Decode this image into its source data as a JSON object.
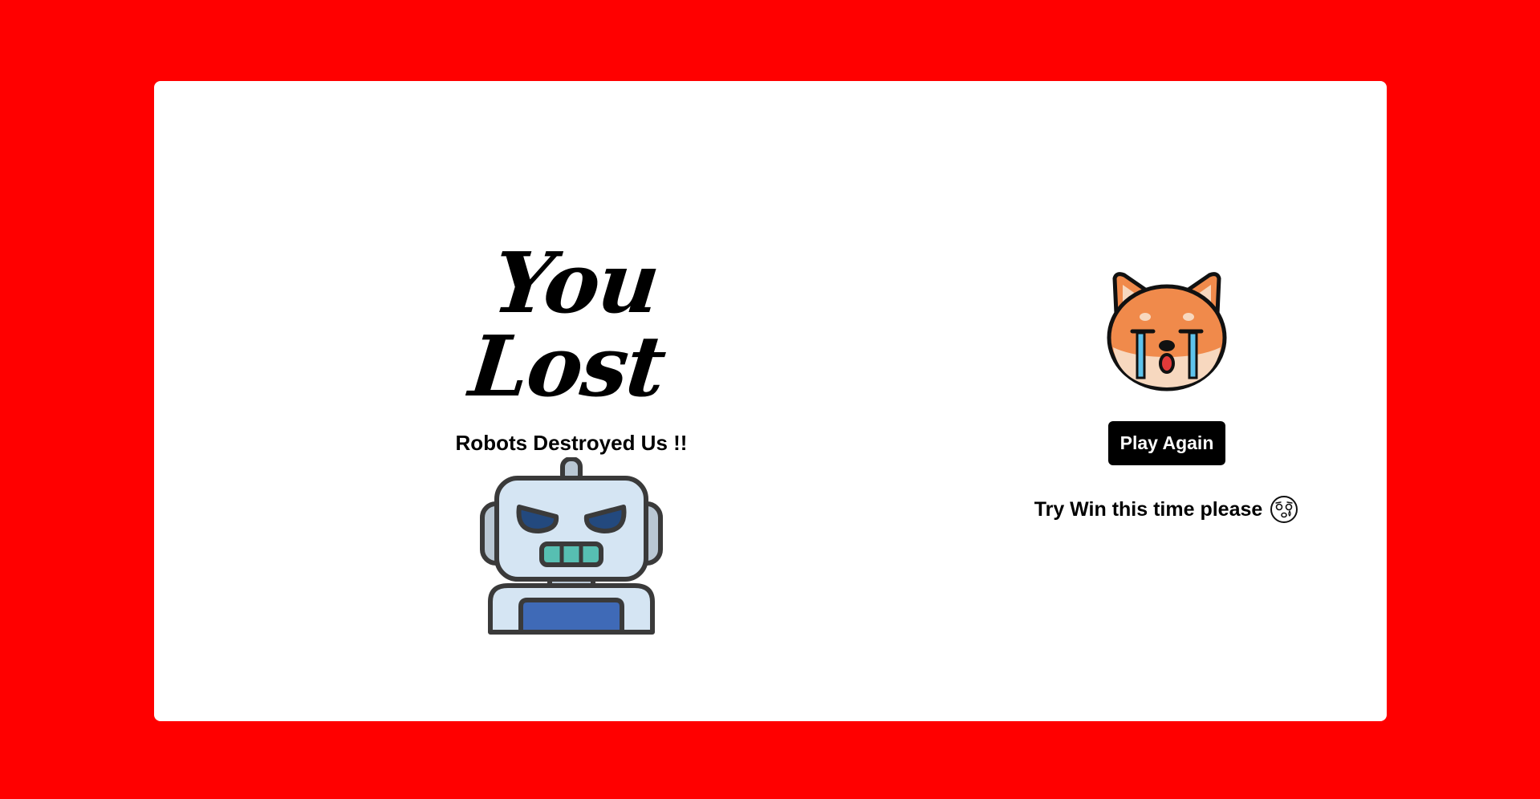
{
  "result": {
    "title": "You Lost",
    "subtitle": "Robots Destroyed Us !!"
  },
  "actions": {
    "play_again_label": "Play Again",
    "hint_text": "Try Win this time please"
  },
  "icons": {
    "robot": "angry-robot-icon",
    "dog": "crying-dog-icon",
    "hint_emoji": "crying-face-icon"
  },
  "colors": {
    "background": "#ff0000",
    "card": "#ffffff",
    "button": "#000000"
  }
}
